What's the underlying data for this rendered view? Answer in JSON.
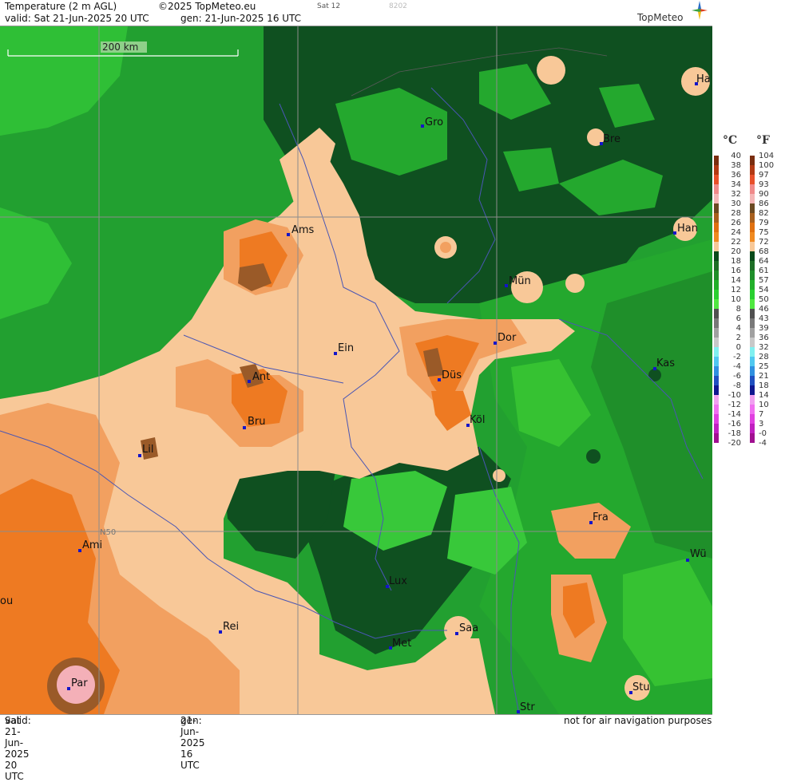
{
  "header": {
    "title": "Temperature (2 m AGL)",
    "copyright": "©2025 TopMeteo.eu",
    "sat_label": "Sat 12",
    "code": "8202",
    "valid_label": "valid:",
    "valid_value": "Sat  21-Jun-2025  20 UTC",
    "gen_label": "gen:",
    "gen_value": "21-Jun-2025 16 UTC",
    "brand": "TopMeteo"
  },
  "footer": {
    "valid_label": "valid:",
    "valid_value": "Sat  21-Jun-2025  20 UTC",
    "gen_label": "gen:",
    "gen_value": "21-Jun-2025 16 UTC",
    "disclaimer": "not for air navigation purposes"
  },
  "map": {
    "scale_label": "200 km",
    "lat_label": "N50",
    "cities": [
      "Ha",
      "Gro",
      "Bre",
      "Ams",
      "Han",
      "Mün",
      "Ein",
      "Dor",
      "Kas",
      "Ant",
      "Düs",
      "Bru",
      "Köl",
      "Lil",
      "Fra",
      "Ami",
      "Wü",
      "Lux",
      "ou",
      "Rei",
      "Saa",
      "Met",
      "Par",
      "Stu",
      "Str"
    ]
  },
  "legend": {
    "unit_c": "°C",
    "unit_f": "°F",
    "celsius": [
      "40",
      "38",
      "36",
      "34",
      "32",
      "30",
      "28",
      "26",
      "24",
      "22",
      "20",
      "18",
      "16",
      "14",
      "12",
      "10",
      "8",
      "6",
      "4",
      "2",
      "0",
      "-2",
      "-4",
      "-6",
      "-8",
      "-10",
      "-12",
      "-14",
      "-16",
      "-18",
      "-20"
    ],
    "fahrenheit": [
      "104",
      "100",
      "97",
      "93",
      "90",
      "86",
      "82",
      "79",
      "75",
      "72",
      "68",
      "64",
      "61",
      "57",
      "54",
      "50",
      "46",
      "43",
      "39",
      "36",
      "32",
      "28",
      "25",
      "21",
      "18",
      "14",
      "10",
      "7",
      "3",
      "-0",
      "-4"
    ],
    "colors": [
      "#7a2e10",
      "#b23a14",
      "#e8502a",
      "#f08a8a",
      "#f4b6b6",
      "#6b4a22",
      "#a8601e",
      "#e07010",
      "#f08a20",
      "#f8c898",
      "#0a4a1a",
      "#1e6e26",
      "#1f8f2a",
      "#22b02a",
      "#2ad030",
      "#50e840",
      "#505050",
      "#787878",
      "#a0a0a0",
      "#c8c8c8",
      "#80f0f0",
      "#50c8f0",
      "#3090e0",
      "#2050c0",
      "#101890",
      "#f0a0f0",
      "#f070f0",
      "#e040e0",
      "#c020c0",
      "#a01090"
    ]
  },
  "colors": {
    "ocean": "#22a030",
    "dark_forest": "#0f5020",
    "mid_green": "#24a82e",
    "bright_green": "#36c832",
    "peach": "#f8c898",
    "light_orange": "#f2a060",
    "orange": "#ee7a22",
    "brown": "#9a5a28",
    "pink": "#f4b0b8",
    "border_blue": "#4a56b4",
    "grid": "#8c8c8c"
  }
}
